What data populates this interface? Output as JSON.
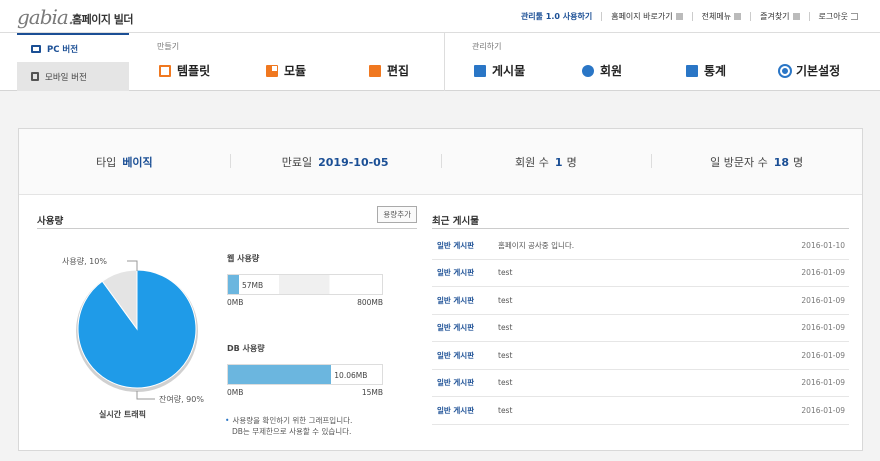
{
  "header": {
    "logo_text": "gabia.",
    "product_name": "홈페이지 빌더",
    "links": [
      {
        "label": "관리툴 1.0 사용하기",
        "icon": ""
      },
      {
        "label": "홈페이지 바로가기",
        "icon": "external-icon"
      },
      {
        "label": "전체메뉴",
        "icon": "menu-icon"
      },
      {
        "label": "즐겨찾기",
        "icon": "bookmark-icon"
      },
      {
        "label": "로그아웃",
        "icon": "logout-icon"
      }
    ]
  },
  "version_tabs": [
    {
      "label": "PC 버전",
      "icon": "monitor-icon",
      "active": true
    },
    {
      "label": "모바일 버전",
      "icon": "mobile-icon",
      "active": false
    }
  ],
  "menu": {
    "make": {
      "title": "만들기",
      "items": [
        {
          "label": "템플릿",
          "icon": "template-icon"
        },
        {
          "label": "모듈",
          "icon": "module-icon"
        },
        {
          "label": "편집",
          "icon": "edit-icon"
        }
      ]
    },
    "manage": {
      "title": "관리하기",
      "items": [
        {
          "label": "게시물",
          "icon": "board-icon"
        },
        {
          "label": "회원",
          "icon": "member-icon"
        },
        {
          "label": "통계",
          "icon": "stats-icon"
        },
        {
          "label": "기본설정",
          "icon": "settings-icon"
        }
      ]
    }
  },
  "info": {
    "type_label": "타입",
    "type_value": "베이직",
    "expire_label": "만료일",
    "expire_value": "2019-10-05",
    "members_label": "회원 수",
    "members_value": "1",
    "members_unit": "명",
    "visitors_label": "일 방문자 수",
    "visitors_value": "18",
    "visitors_unit": "명"
  },
  "usage": {
    "title": "사용량",
    "add_button": "용량추가",
    "pie_used_label": "사용량, 10%",
    "pie_free_label": "잔여량, 90%",
    "used_fraction": 0.1,
    "pie_caption": "실시간 트래픽",
    "colors": {
      "free": "#1f9be8",
      "used": "#e4e4e4"
    },
    "web": {
      "title": "웹 사용량",
      "value_label": "57MB",
      "min_label": "0MB",
      "max_label": "800MB",
      "fraction": 0.07125
    },
    "db": {
      "title": "DB 사용량",
      "value_label": "10.06MB",
      "min_label": "0MB",
      "max_label": "15MB",
      "fraction": 0.6707
    },
    "note_line1": "사용량을 확인하기 위한 그래프입니다.",
    "note_line2": "DB는 무제한으로 사용할 수 있습니다."
  },
  "recent": {
    "title": "최근 게시물",
    "posts": [
      {
        "category": "일반 게시판",
        "title": "홈페이지 공사중 입니다.",
        "date": "2016-01-10"
      },
      {
        "category": "일반 게시판",
        "title": "test",
        "date": "2016-01-09"
      },
      {
        "category": "일반 게시판",
        "title": "test",
        "date": "2016-01-09"
      },
      {
        "category": "일반 게시판",
        "title": "test",
        "date": "2016-01-09"
      },
      {
        "category": "일반 게시판",
        "title": "test",
        "date": "2016-01-09"
      },
      {
        "category": "일반 게시판",
        "title": "test",
        "date": "2016-01-09"
      },
      {
        "category": "일반 게시판",
        "title": "test",
        "date": "2016-01-09"
      }
    ]
  }
}
